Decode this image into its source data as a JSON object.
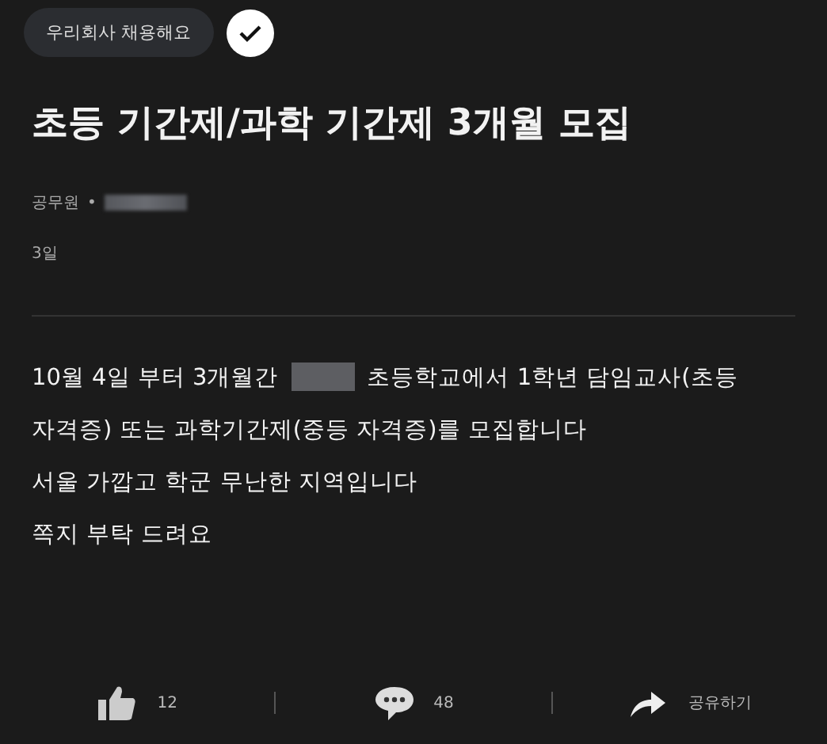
{
  "badge": {
    "label": "우리회사 채용해요"
  },
  "title": "초등 기간제/과학 기간제 3개월 모집",
  "meta": {
    "category": "공무원",
    "separator": "•",
    "company_redacted": true
  },
  "time": "3일",
  "body": [
    {
      "segments": [
        {
          "kind": "text",
          "text": "10월 4일 부터 3개월간"
        },
        {
          "kind": "redacted"
        },
        {
          "kind": "text",
          "text": "초등학교에서 1학년 담임교사(초등"
        }
      ]
    },
    {
      "segments": [
        {
          "kind": "text",
          "text": "자격증) 또는 과학기간제(중등 자격증)를 모집합니다"
        }
      ]
    },
    {
      "segments": [
        {
          "kind": "text",
          "text": "서울 가깝고 학군 무난한 지역입니다"
        }
      ]
    },
    {
      "segments": [
        {
          "kind": "text",
          "text": "쪽지 부탁 드려요"
        }
      ]
    }
  ],
  "actions": [
    {
      "kind": "like",
      "label": "12"
    },
    {
      "kind": "comment",
      "label": "48"
    },
    {
      "kind": "share",
      "label": "공유하기"
    }
  ]
}
